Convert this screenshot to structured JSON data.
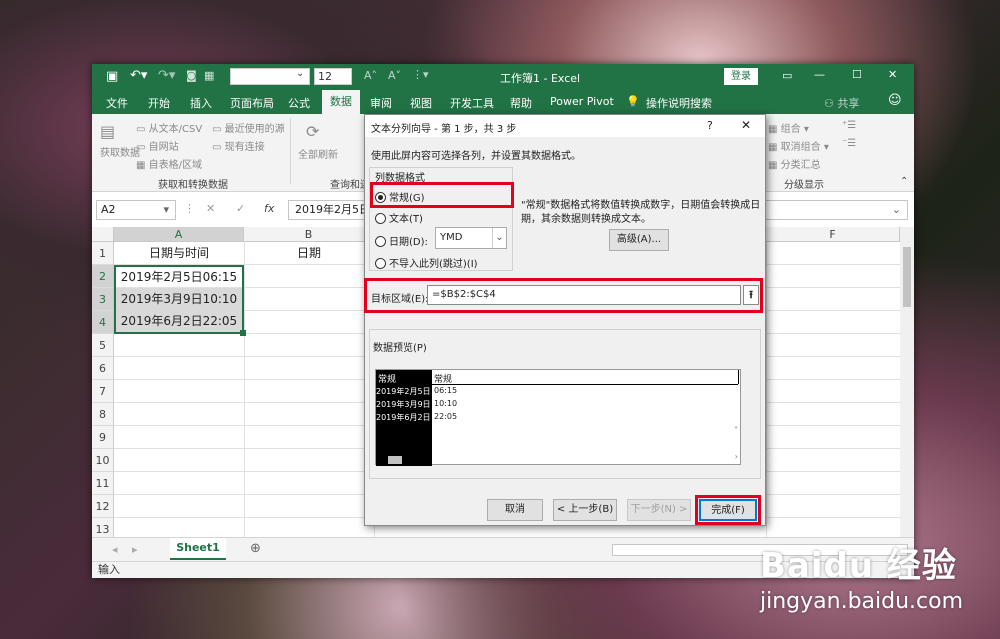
{
  "excel": {
    "title": "工作簿1 - Excel",
    "login": "登录",
    "font_size": "12",
    "tabs": [
      "文件",
      "开始",
      "插入",
      "页面布局",
      "公式",
      "数据",
      "审阅",
      "视图",
      "开发工具",
      "帮助",
      "Power Pivot"
    ],
    "tell_me": "操作说明搜索",
    "share": "共享",
    "ribbon": {
      "get_data": "获取数据",
      "from_text": "从文本/CSV",
      "from_web": "自网站",
      "from_table": "自表格/区域",
      "recent": "最近使用的源",
      "existing": "现有连接",
      "group_get": "获取和转换数据",
      "refresh_all": "全部刷新",
      "group_query": "查询和连",
      "group_outline": "分级显示",
      "outline_items": [
        "组合",
        "取消组合",
        "分类汇总"
      ]
    },
    "name_box": "A2",
    "fx": "fx",
    "formula": "2019年2月5日",
    "columns": [
      "A",
      "B",
      "F"
    ],
    "rows": [
      "1",
      "2",
      "3",
      "4",
      "5",
      "6",
      "7",
      "8",
      "9",
      "10",
      "11",
      "12",
      "13"
    ],
    "cells": {
      "A1": "日期与时间",
      "B1": "日期",
      "A2": "2019年2月5日06:15",
      "A3": "2019年3月9日10:10",
      "A4": "2019年6月2日22:05"
    },
    "sheet_tab": "Sheet1",
    "status": "输入"
  },
  "dialog": {
    "title": "文本分列向导 - 第 1 步，共 3 步",
    "help": "?",
    "close": "✕",
    "instruction": "使用此屏内容可选择各列，并设置其数据格式。",
    "group_label": "列数据格式",
    "opt_general": "常规(G)",
    "opt_text": "文本(T)",
    "opt_date": "日期(D):",
    "date_format": "YMD",
    "opt_skip": "不导入此列(跳过)(I)",
    "description": "\"常规\"数据格式将数值转换成数字，日期值会转换成日期，其余数据则转换成文本。",
    "advanced": "高级(A)...",
    "dest_label": "目标区域(E):",
    "dest_value": "=$B$2:$C$4",
    "preview_label": "数据预览(P)",
    "preview_headers": [
      "常规",
      "常规"
    ],
    "preview_col1": [
      "2019年2月5日",
      "2019年3月9日",
      "2019年6月2日"
    ],
    "preview_col2": [
      "06:15",
      "10:10",
      "22:05"
    ],
    "btn_cancel": "取消",
    "btn_back": "< 上一步(B)",
    "btn_next": "下一步(N) >",
    "btn_finish": "完成(F)"
  },
  "watermark": {
    "brand": "Baidu 经验",
    "url": "jingyan.baidu.com"
  },
  "colors": {
    "excel_green": "#217346",
    "highlight": "#e3001b"
  }
}
